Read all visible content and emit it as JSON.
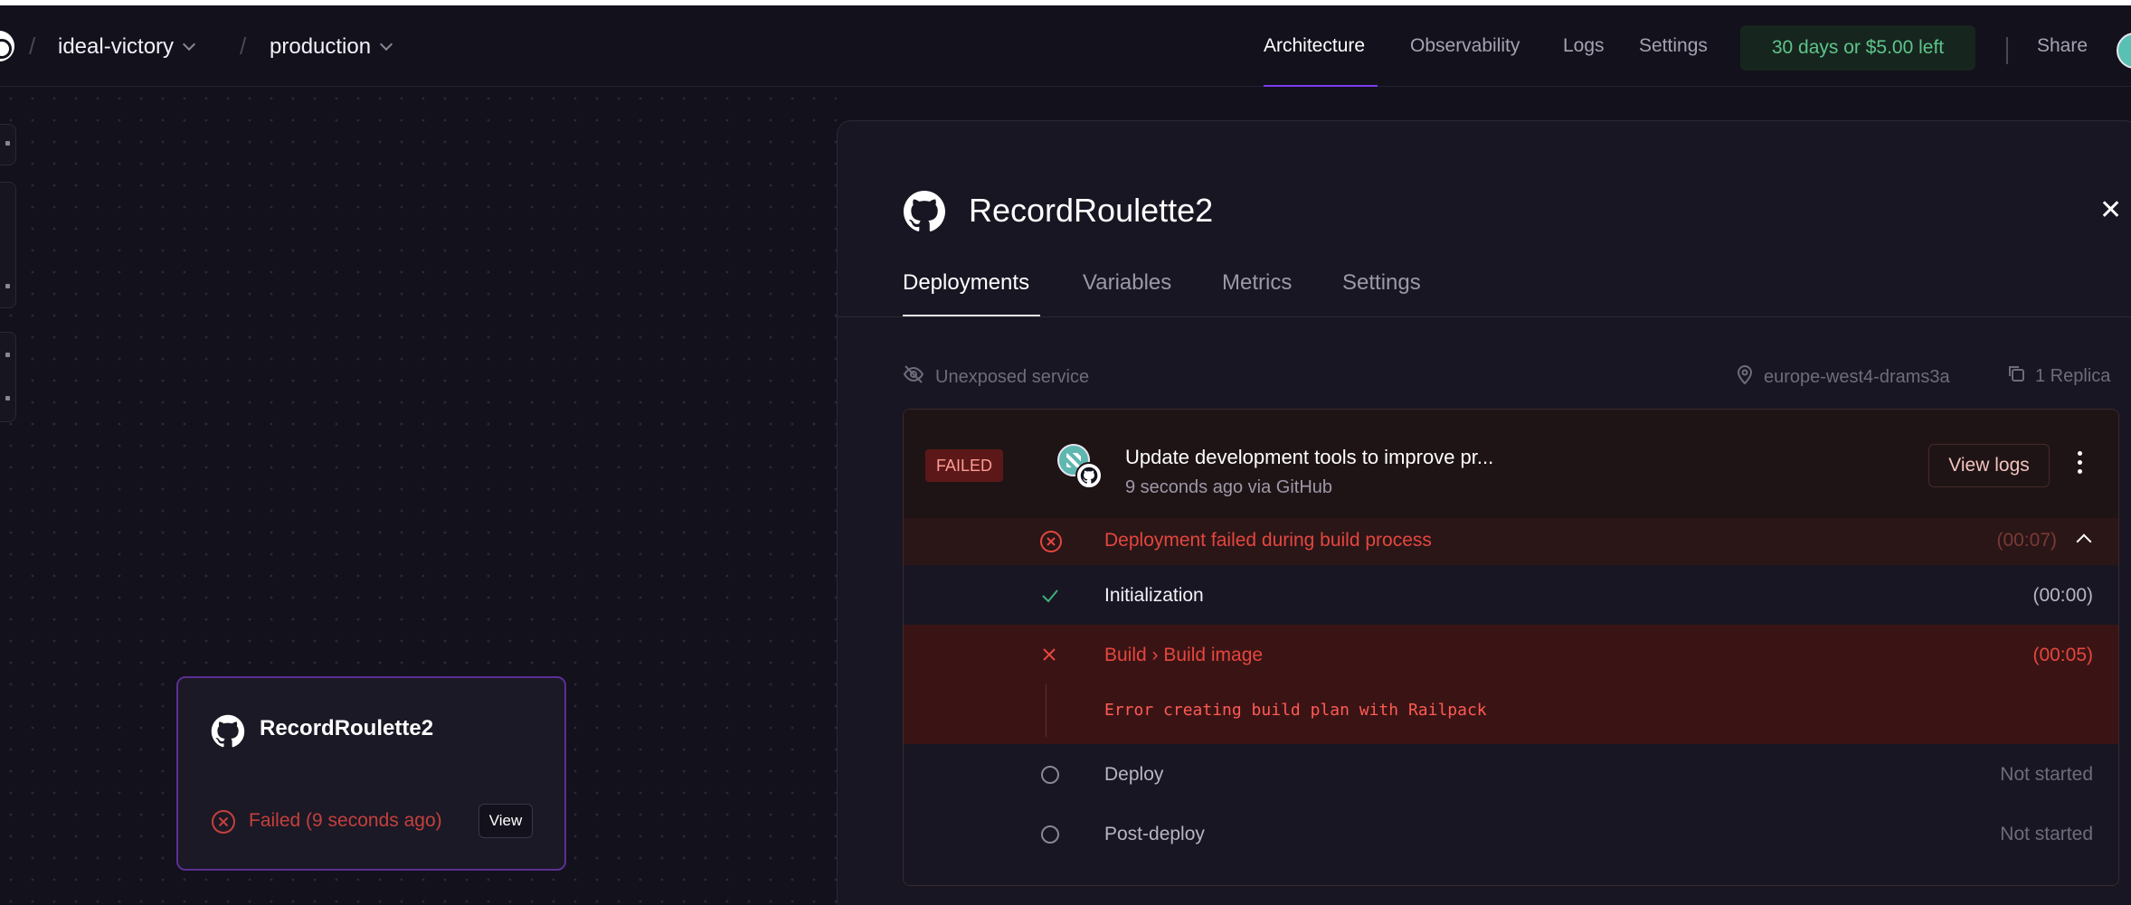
{
  "header": {
    "project": "ideal-victory",
    "environment": "production",
    "nav": [
      "Architecture",
      "Observability",
      "Logs",
      "Settings"
    ],
    "active_nav": "Architecture",
    "trial": "30 days or $5.00 left",
    "share": "Share"
  },
  "canvas": {
    "service_card": {
      "name": "RecordRoulette2",
      "status": "Failed (9 seconds ago)",
      "view_label": "View"
    }
  },
  "panel": {
    "title": "RecordRoulette2",
    "tabs": [
      "Deployments",
      "Variables",
      "Metrics",
      "Settings"
    ],
    "active_tab": "Deployments",
    "exposure": "Unexposed service",
    "region": "europe-west4-drams3a",
    "replicas": "1 Replica",
    "deployment": {
      "status_badge": "FAILED",
      "commit_message": "Update development tools to improve pr...",
      "commit_meta": "9 seconds ago via GitHub",
      "view_logs": "View logs",
      "summary": {
        "label": "Deployment failed during build process",
        "time": "(00:07)"
      },
      "steps": [
        {
          "label": "Initialization",
          "time": "(00:00)",
          "state": "success"
        },
        {
          "label": "Build › Build image",
          "time": "(00:05)",
          "state": "failed",
          "error": "Error creating build plan with Railpack"
        },
        {
          "label": "Deploy",
          "time": "Not started",
          "state": "pending"
        },
        {
          "label": "Post-deploy",
          "time": "Not started",
          "state": "pending"
        }
      ]
    }
  },
  "colors": {
    "background": "#13111c",
    "accent": "#7c3aed",
    "error": "#ff5a55",
    "success": "#5fc48a"
  }
}
